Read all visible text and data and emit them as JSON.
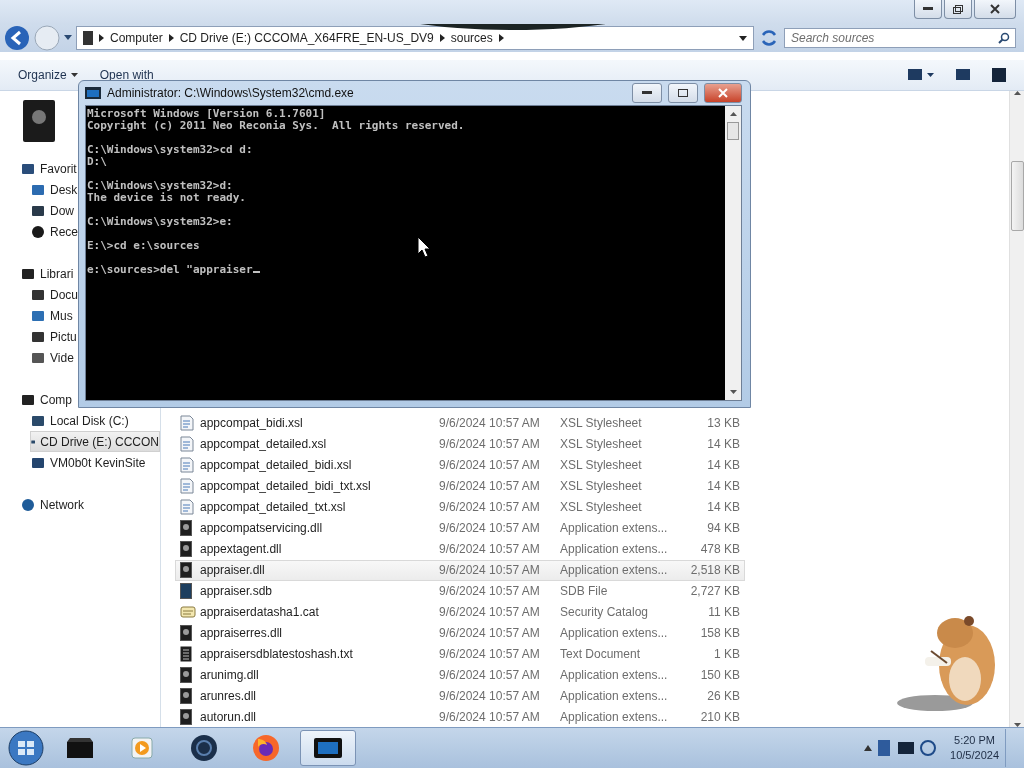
{
  "explorer": {
    "breadcrumbs": [
      "Computer",
      "CD Drive (E:) CCCOMA_X64FRE_EN-US_DV9",
      "sources"
    ],
    "search": {
      "placeholder": "Search sources"
    },
    "toolbar": {
      "organize": "Organize",
      "open_with": "Open with"
    },
    "sidebar": [
      {
        "label": "Favorit",
        "kind": "star",
        "selected": false,
        "children": [
          {
            "label": "Desk",
            "kind": "desktop",
            "selected": false
          },
          {
            "label": "Dow",
            "kind": "download",
            "selected": false
          },
          {
            "label": "Rece",
            "kind": "recent",
            "selected": false
          }
        ]
      },
      {
        "label": "Librari",
        "kind": "library",
        "selected": false,
        "children": [
          {
            "label": "Docu",
            "kind": "document",
            "selected": false
          },
          {
            "label": "Mus",
            "kind": "music",
            "selected": false
          },
          {
            "label": "Pictu",
            "kind": "picture",
            "selected": false
          },
          {
            "label": "Vide",
            "kind": "video",
            "selected": false
          }
        ]
      },
      {
        "label": "Comp",
        "kind": "computer",
        "selected": false,
        "children": [
          {
            "label": "Local Disk (C:)",
            "kind": "disk",
            "selected": false
          },
          {
            "label": "CD Drive (E:) CCCON",
            "kind": "disk",
            "selected": true
          },
          {
            "label": "VM0b0t KevinSite",
            "kind": "netdrive",
            "selected": false
          }
        ]
      },
      {
        "label": "Network",
        "kind": "network",
        "selected": false
      }
    ],
    "files": [
      {
        "name": "appcompat_bidi.xsl",
        "date": "9/6/2024 10:57 AM",
        "type": "XSL Stylesheet",
        "size": "13 KB",
        "kind": "xsl",
        "selected": false
      },
      {
        "name": "appcompat_detailed.xsl",
        "date": "9/6/2024 10:57 AM",
        "type": "XSL Stylesheet",
        "size": "14 KB",
        "kind": "xsl",
        "selected": false
      },
      {
        "name": "appcompat_detailed_bidi.xsl",
        "date": "9/6/2024 10:57 AM",
        "type": "XSL Stylesheet",
        "size": "14 KB",
        "kind": "xsl",
        "selected": false
      },
      {
        "name": "appcompat_detailed_bidi_txt.xsl",
        "date": "9/6/2024 10:57 AM",
        "type": "XSL Stylesheet",
        "size": "14 KB",
        "kind": "xsl",
        "selected": false
      },
      {
        "name": "appcompat_detailed_txt.xsl",
        "date": "9/6/2024 10:57 AM",
        "type": "XSL Stylesheet",
        "size": "14 KB",
        "kind": "xsl",
        "selected": false
      },
      {
        "name": "appcompatservicing.dll",
        "date": "9/6/2024 10:57 AM",
        "type": "Application extens...",
        "size": "94 KB",
        "kind": "dll",
        "selected": false
      },
      {
        "name": "appextagent.dll",
        "date": "9/6/2024 10:57 AM",
        "type": "Application extens...",
        "size": "478 KB",
        "kind": "dll",
        "selected": false
      },
      {
        "name": "appraiser.dll",
        "date": "9/6/2024 10:57 AM",
        "type": "Application extens...",
        "size": "2,518 KB",
        "kind": "dll",
        "selected": true
      },
      {
        "name": "appraiser.sdb",
        "date": "9/6/2024 10:57 AM",
        "type": "SDB File",
        "size": "2,727 KB",
        "kind": "sdb",
        "selected": false
      },
      {
        "name": "appraiserdatasha1.cat",
        "date": "9/6/2024 10:57 AM",
        "type": "Security Catalog",
        "size": "11 KB",
        "kind": "cat",
        "selected": false
      },
      {
        "name": "appraiserres.dll",
        "date": "9/6/2024 10:57 AM",
        "type": "Application extens...",
        "size": "158 KB",
        "kind": "dll",
        "selected": false
      },
      {
        "name": "appraisersdblatestoshash.txt",
        "date": "9/6/2024 10:57 AM",
        "type": "Text Document",
        "size": "1 KB",
        "kind": "txt",
        "selected": false
      },
      {
        "name": "arunimg.dll",
        "date": "9/6/2024 10:57 AM",
        "type": "Application extens...",
        "size": "150 KB",
        "kind": "dll",
        "selected": false
      },
      {
        "name": "arunres.dll",
        "date": "9/6/2024 10:57 AM",
        "type": "Application extens...",
        "size": "26 KB",
        "kind": "dll",
        "selected": false
      },
      {
        "name": "autorun.dll",
        "date": "9/6/2024 10:57 AM",
        "type": "Application extens...",
        "size": "210 KB",
        "kind": "dll",
        "selected": false
      }
    ]
  },
  "console": {
    "title": "Administrator: C:\\Windows\\System32\\cmd.exe",
    "blocks": [
      [
        "Microsoft Windows [Version 6.1.7601]",
        "Copyright (c) 2011 Neo Reconia Sys.  All rights reserved."
      ],
      [
        "C:\\Windows\\system32>cd d:",
        "D:\\"
      ],
      [
        "C:\\Windows\\system32>d:",
        "The device is not ready."
      ],
      [
        "C:\\Windows\\system32>e:"
      ],
      [
        "E:\\>cd e:\\sources"
      ],
      [
        "e:\\sources>del \"appraiser"
      ]
    ]
  },
  "taskbar": {
    "apps": [
      {
        "kind": "explorer",
        "active": false
      },
      {
        "kind": "media",
        "active": false
      },
      {
        "kind": "globe",
        "active": false
      },
      {
        "kind": "firefox",
        "active": false
      },
      {
        "kind": "console",
        "active": true
      }
    ],
    "time": "5:20 PM",
    "date": "10/5/2024"
  }
}
